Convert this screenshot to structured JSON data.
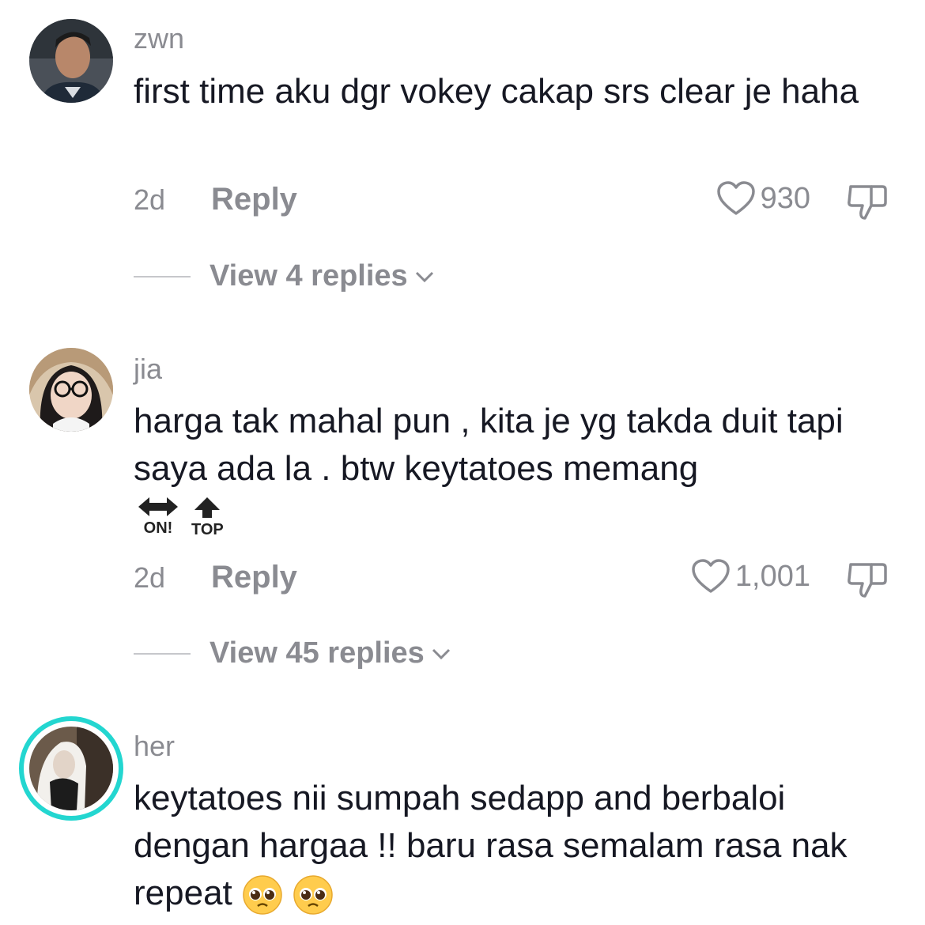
{
  "comments": [
    {
      "username": "zwn",
      "text": "first time aku dgr vokey cakap srs clear je haha",
      "time": "2d",
      "reply_label": "Reply",
      "likes": "930",
      "view_replies": "View 4 replies",
      "avatar": "photo"
    },
    {
      "username": "jia",
      "text": "harga tak mahal pun , kita je yg takda duit tapi saya ada la . btw keytatoes memang",
      "stickers": [
        {
          "icon": "left-right-arrow-icon",
          "label": "ON!"
        },
        {
          "icon": "up-arrow-icon",
          "label": "TOP"
        }
      ],
      "time": "2d",
      "reply_label": "Reply",
      "likes": "1,001",
      "view_replies": "View 45 replies",
      "avatar": "photo"
    },
    {
      "username": "her",
      "text": "keytatoes nii sumpah sedapp and berbaloi dengan hargaa !! baru rasa semalam rasa nak repeat",
      "emojis": [
        "pleading-face-icon",
        "pleading-face-icon"
      ],
      "avatar": "photo-with-story-ring"
    }
  ],
  "colors": {
    "text": "#161823",
    "muted": "#8a8b91",
    "story_ring": "#23d6d0"
  }
}
